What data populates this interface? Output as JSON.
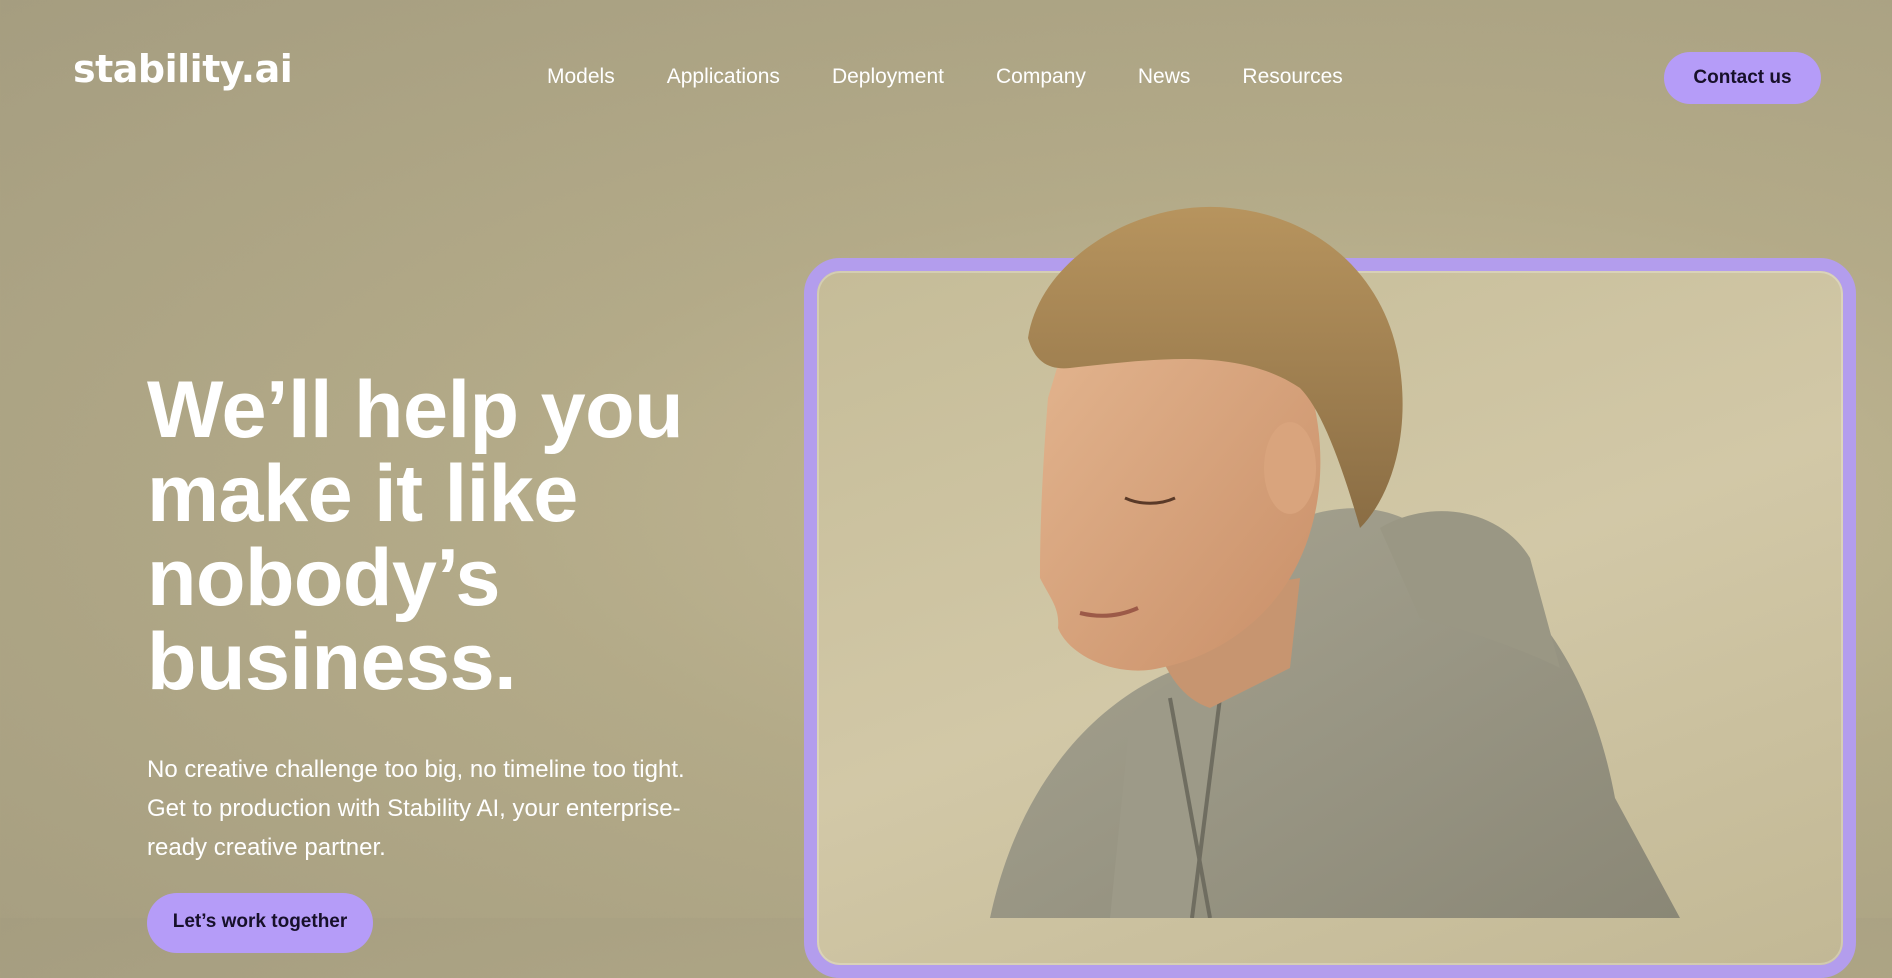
{
  "brand": {
    "logo_text": "stability.ai"
  },
  "nav": {
    "items": [
      {
        "label": "Models"
      },
      {
        "label": "Applications"
      },
      {
        "label": "Deployment"
      },
      {
        "label": "Company"
      },
      {
        "label": "News"
      },
      {
        "label": "Resources"
      }
    ],
    "contact_label": "Contact us"
  },
  "hero": {
    "headline": "We’ll help you make it like nobody’s business.",
    "subtext": "No creative challenge too big, no timeline too tight. Get to production with Stability AI, your enterprise-ready creative partner.",
    "cta_label": "Let’s work together"
  },
  "colors": {
    "accent": "#b59cf8",
    "frame": "#b39ded",
    "background": "#b3aa88",
    "text": "#ffffff"
  },
  "icons": {
    "hero_image": "person-portrait-image"
  }
}
